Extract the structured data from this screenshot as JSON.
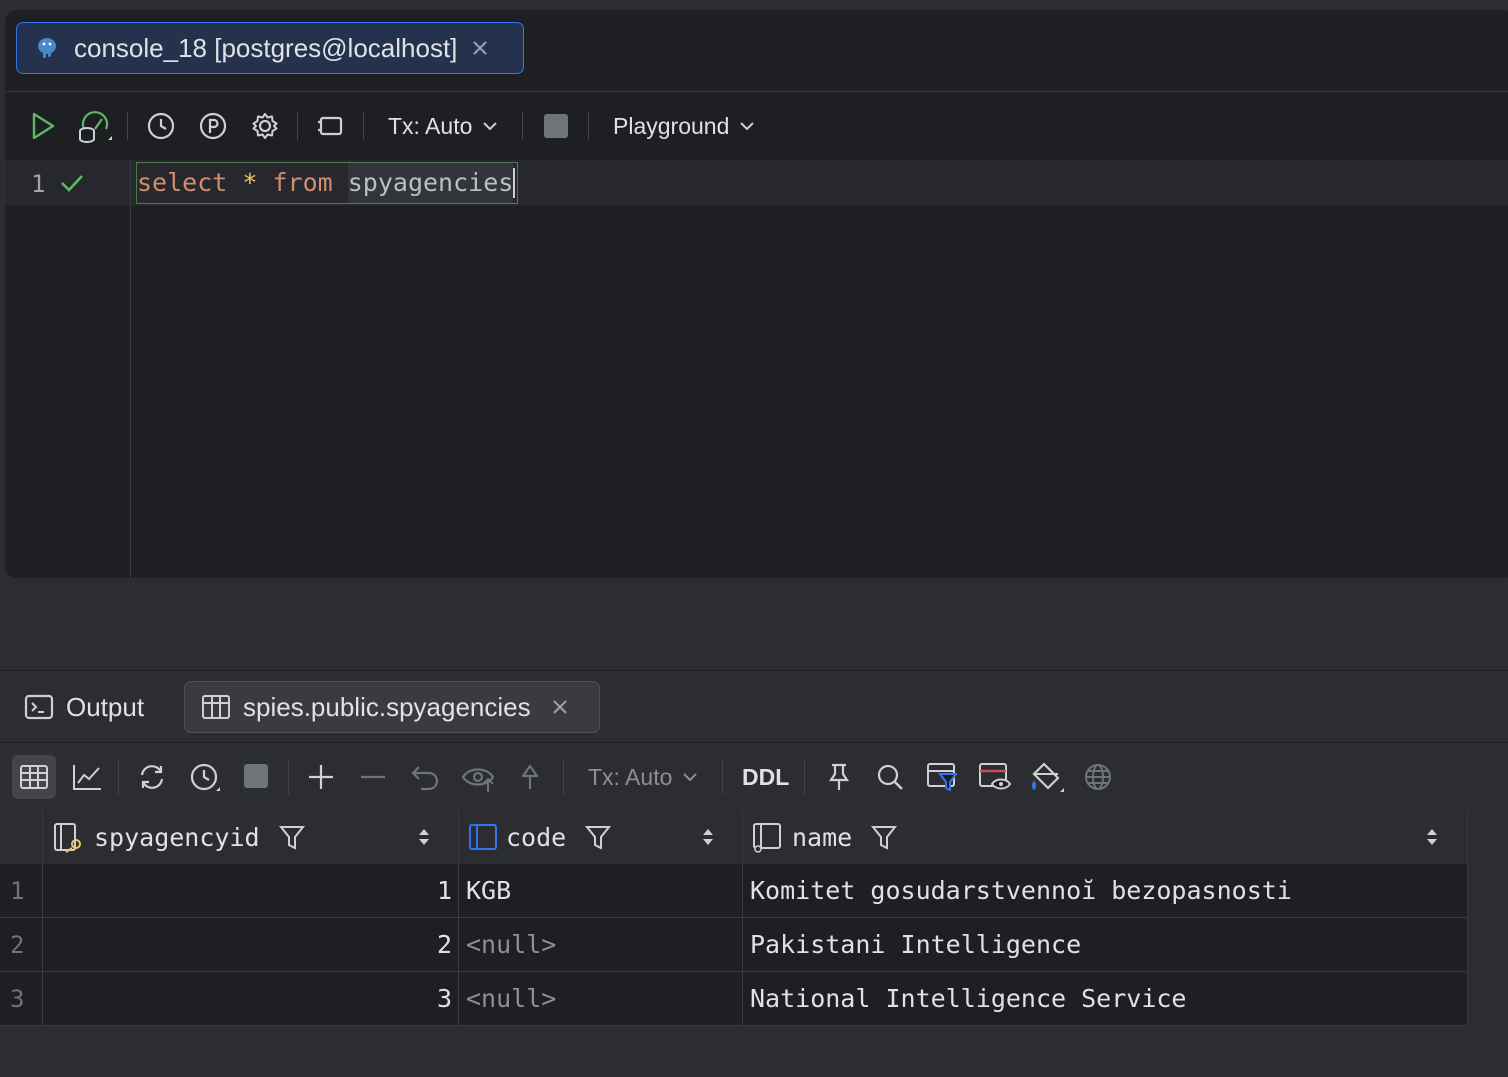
{
  "console_tab": {
    "title": "console_18 [postgres@localhost]"
  },
  "editor_toolbar": {
    "tx_label": "Tx: Auto",
    "playground_label": "Playground"
  },
  "editor": {
    "line_number": "1",
    "code": {
      "kw1": "select",
      "star": " * ",
      "kw2": "from",
      "space": " ",
      "ident": "spyagencies"
    }
  },
  "bottom_tabs": {
    "output_label": "Output",
    "result_label": "spies.public.spyagencies"
  },
  "result_toolbar": {
    "tx_label": "Tx: Auto",
    "ddl_label": "DDL"
  },
  "table": {
    "columns": [
      "spyagencyid",
      "code",
      "name"
    ],
    "rows": [
      {
        "num": "1",
        "spyagencyid": "1",
        "code": "KGB",
        "name": "Komitet gosudarstvennoĭ bezopasnosti"
      },
      {
        "num": "2",
        "spyagencyid": "2",
        "code": "<null>",
        "name": "Pakistani Intelligence"
      },
      {
        "num": "3",
        "spyagencyid": "3",
        "code": "<null>",
        "name": "National Intelligence Service"
      }
    ]
  },
  "colors": {
    "accent": "#3574f0",
    "keyword": "#cf8e6d",
    "success": "#5fb865"
  }
}
